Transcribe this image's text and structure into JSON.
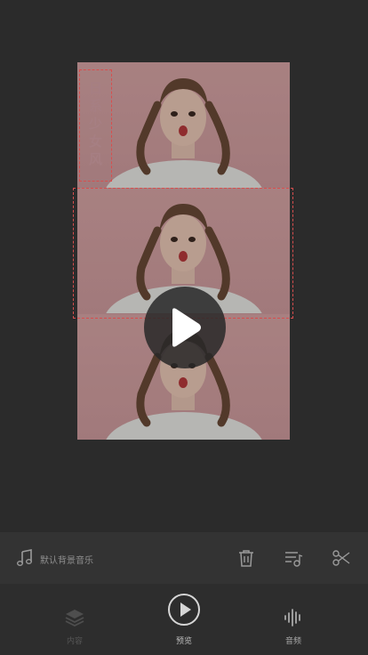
{
  "canvas": {
    "title_text": "日系少女风"
  },
  "player": {
    "play_icon": "play-icon"
  },
  "music": {
    "label": "默认背景音乐",
    "icon": "music-note-icon"
  },
  "toolbar": {
    "delete_icon": "trash-icon",
    "playlist_icon": "playlist-music-icon",
    "cut_icon": "scissors-icon"
  },
  "nav": {
    "items": [
      {
        "label": "内容",
        "icon": "layers-icon",
        "active": false
      },
      {
        "label": "预览",
        "icon": "play-circle-icon",
        "active": true
      },
      {
        "label": "音频",
        "icon": "waveform-icon",
        "active": false
      }
    ]
  },
  "colors": {
    "background": "#2b2b2b",
    "canvas_pink": "#cf9ea0",
    "dashed_red": "#d84e4e",
    "bar": "#333333"
  }
}
